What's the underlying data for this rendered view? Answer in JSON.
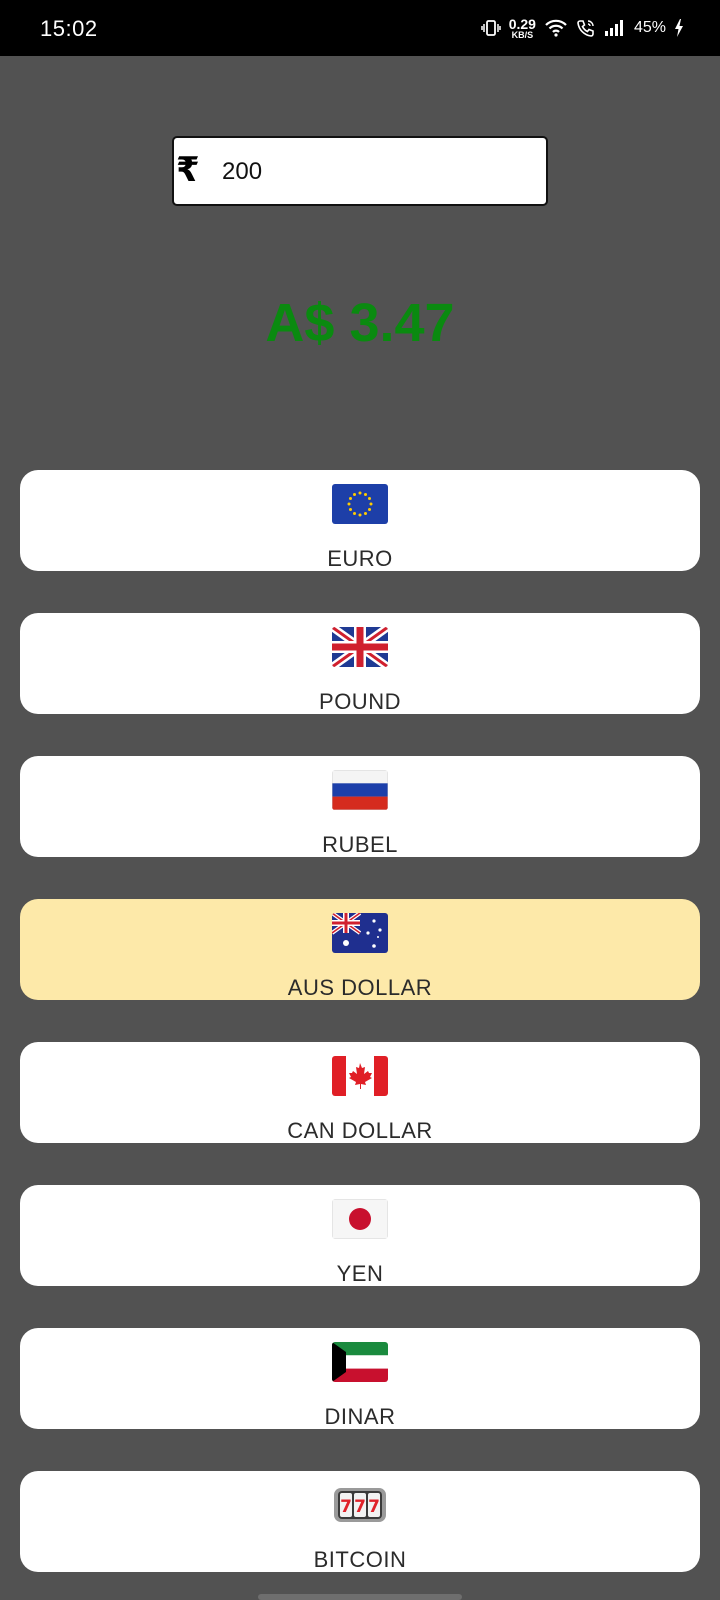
{
  "status_bar": {
    "time": "15:02",
    "net_speed_value": "0.29",
    "net_speed_unit": "KB/S",
    "battery": "45%"
  },
  "converter": {
    "currency_symbol": "₹",
    "amount": "200",
    "result": "A$ 3.47",
    "result_color": "#0a8a10"
  },
  "currencies": [
    {
      "label": "EURO",
      "icon": "eu-flag-icon",
      "selected": false
    },
    {
      "label": "POUND",
      "icon": "uk-flag-icon",
      "selected": false
    },
    {
      "label": "RUBEL",
      "icon": "russia-flag-icon",
      "selected": false
    },
    {
      "label": "AUS DOLLAR",
      "icon": "australia-flag-icon",
      "selected": true
    },
    {
      "label": "CAN DOLLAR",
      "icon": "canada-flag-icon",
      "selected": false
    },
    {
      "label": "YEN",
      "icon": "japan-flag-icon",
      "selected": false
    },
    {
      "label": "DINAR",
      "icon": "kuwait-flag-icon",
      "selected": false
    },
    {
      "label": "BITCOIN",
      "icon": "slot-machine-icon",
      "selected": false
    }
  ],
  "colors": {
    "background": "#525252",
    "selected_button": "#fde9a9"
  }
}
